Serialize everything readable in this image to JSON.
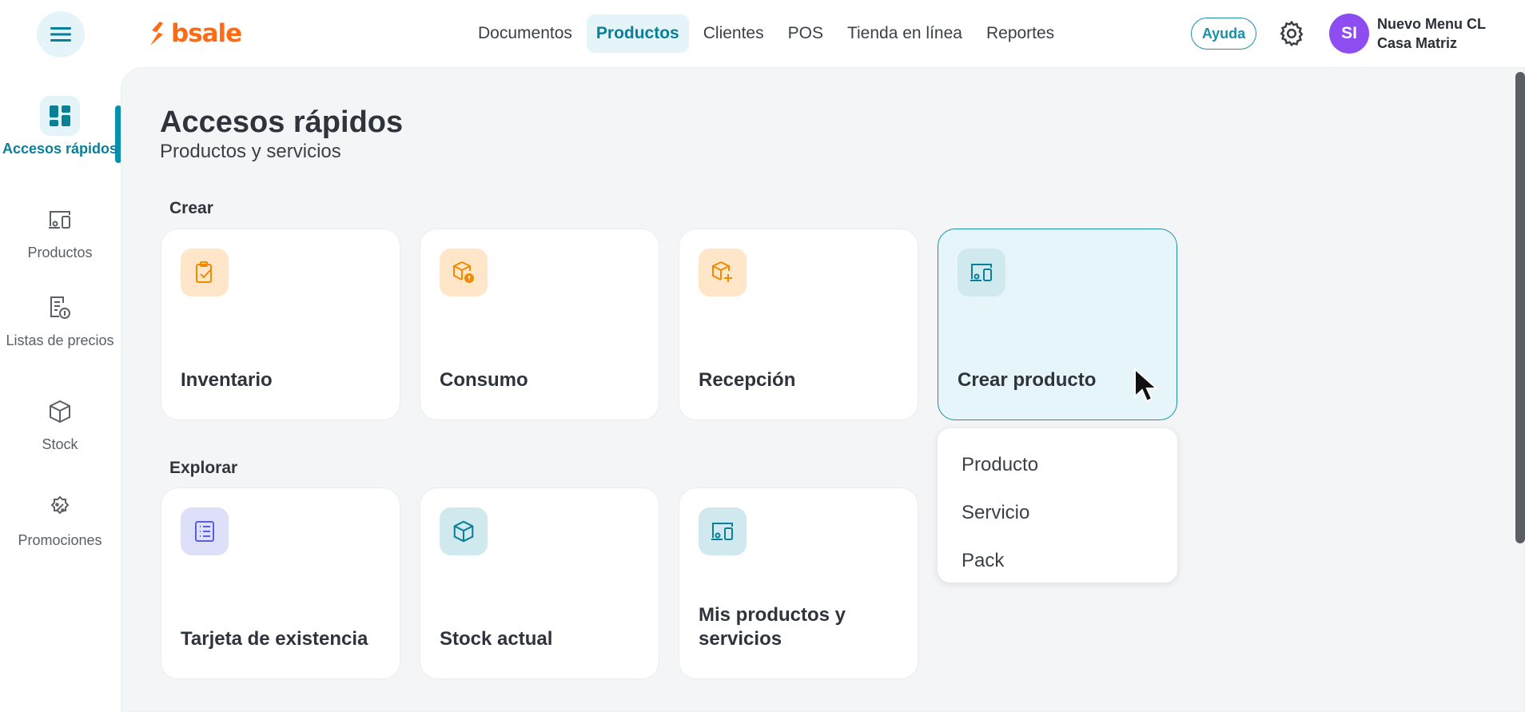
{
  "header": {
    "logo_text": "bsale",
    "nav": [
      {
        "label": "Documentos",
        "active": false
      },
      {
        "label": "Productos",
        "active": true
      },
      {
        "label": "Clientes",
        "active": false
      },
      {
        "label": "POS",
        "active": false
      },
      {
        "label": "Tienda en línea",
        "active": false
      },
      {
        "label": "Reportes",
        "active": false
      }
    ],
    "help_label": "Ayuda",
    "user": {
      "initials": "SI",
      "name": "Nuevo Menu CL",
      "branch": "Casa Matriz"
    }
  },
  "sidebar": {
    "items": [
      {
        "label": "Accesos rápidos",
        "icon": "dashboard-icon",
        "active": true
      },
      {
        "label": "Productos",
        "icon": "products-icon",
        "active": false
      },
      {
        "label": "Listas de precios",
        "icon": "price-list-icon",
        "active": false
      },
      {
        "label": "Stock",
        "icon": "box-icon",
        "active": false
      },
      {
        "label": "Promociones",
        "icon": "discount-icon",
        "active": false
      }
    ]
  },
  "main": {
    "title": "Accesos rápidos",
    "subtitle": "Productos y servicios",
    "sections": [
      {
        "heading": "Crear",
        "cards": [
          {
            "label": "Inventario",
            "icon": "clipboard-check-icon"
          },
          {
            "label": "Consumo",
            "icon": "box-alert-icon"
          },
          {
            "label": "Recepción",
            "icon": "box-plus-icon"
          },
          {
            "label": "Crear producto",
            "icon": "products-icon"
          }
        ]
      },
      {
        "heading": "Explorar",
        "cards": [
          {
            "label": "Tarjeta de existencia",
            "icon": "list-card-icon"
          },
          {
            "label": "Stock actual",
            "icon": "box-icon"
          },
          {
            "label": "Mis productos y servicios",
            "icon": "products-icon"
          }
        ]
      }
    ],
    "create_product_menu": [
      "Producto",
      "Servicio",
      "Pack"
    ]
  },
  "colors": {
    "brand_orange": "#ff6a13",
    "accent_teal": "#0a7f98",
    "avatar_purple": "#8d4df0"
  }
}
